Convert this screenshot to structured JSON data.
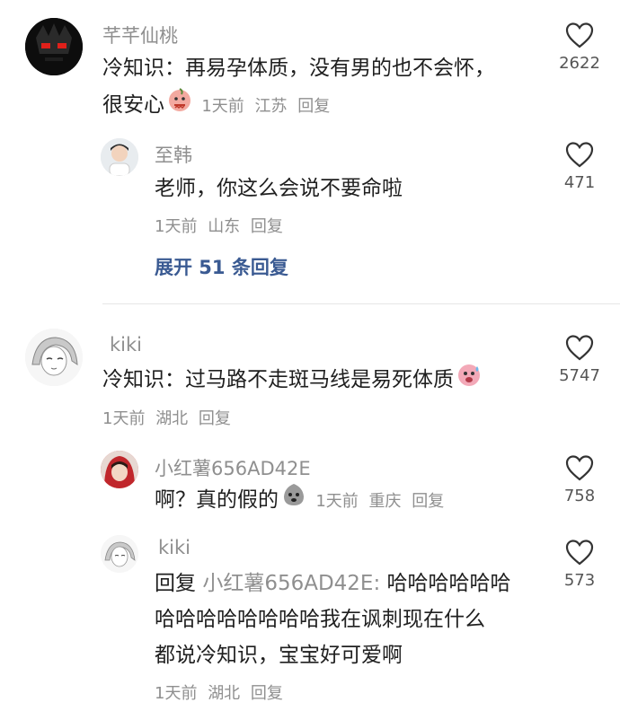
{
  "comments": [
    {
      "username": "芊芊仙桃",
      "text_line1": "冷知识：再易孕体质，没有男的也不会怀，",
      "text_line2": "很安心",
      "emoji": "nervous-peach-emoji",
      "time": "1天前",
      "location": "江苏",
      "reply_label": "回复",
      "likes": "2622",
      "replies": [
        {
          "username": "至韩",
          "text": "老师，你这么会说不要命啦",
          "time": "1天前",
          "location": "山东",
          "reply_label": "回复",
          "likes": "471"
        }
      ],
      "expand_label": "展开 51 条回复"
    },
    {
      "username": "kiki",
      "text": "冷知识：过马路不走斑马线是易死体质",
      "emoji": "sweating-face-emoji",
      "time": "1天前",
      "location": "湖北",
      "reply_label": "回复",
      "likes": "5747",
      "replies": [
        {
          "username": "小红薯656AD42E",
          "text": "啊？真的假的",
          "emoji": "shocked-emoji",
          "time": "1天前",
          "location": "重庆",
          "reply_label": "回复",
          "likes": "758"
        },
        {
          "username": "kiki",
          "reply_prefix": "回复",
          "quoted_user": "小红薯656AD42E:",
          "text_line1": "哈哈哈哈哈哈",
          "text_line2": "哈哈哈哈哈哈哈哈我在讽刺现在什么",
          "text_line3": "都说冷知识，宝宝好可爱啊",
          "time": "1天前",
          "location": "湖北",
          "reply_label": "回复",
          "likes": "573"
        }
      ]
    }
  ],
  "colors": {
    "name": "#8f8f8f",
    "text": "#1f1f1f",
    "link": "#3a5a92",
    "icon": "#555555"
  }
}
